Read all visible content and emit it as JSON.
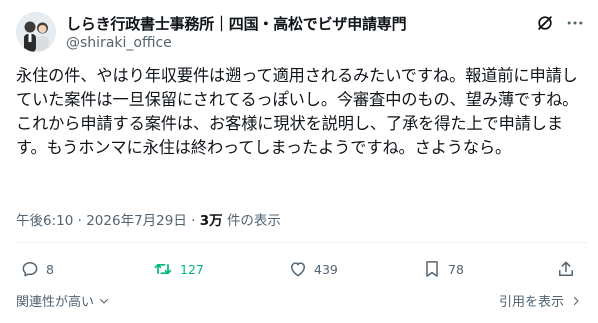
{
  "account": {
    "display_name": "しらき行政書士事務所｜四国・高松でビザ申請専門",
    "handle": "@shiraki_office"
  },
  "post": {
    "text": "永住の件、やはり年収要件は遡って適用されるみたいですね。報道前に申請していた案件は一旦保留にされてるっぽいし。今審査中のもの、望み薄ですね。これから申請する案件は、お客様に現状を説明し、了承を得た上で申請します。もうホンマに永住は終わってしまったようですね。さようなら。",
    "time": "午後6:10",
    "date": "2026年7月29日",
    "views_count": "3万",
    "views_label": "件の表示"
  },
  "actions": {
    "replies": "8",
    "reposts": "127",
    "likes": "439",
    "bookmarks": "78"
  },
  "footer": {
    "sort_label": "関連性が高い",
    "quotes_label": "引用を表示"
  },
  "colors": {
    "text": "#0f1419",
    "secondary": "#536471",
    "repost_active": "#00ba7c"
  }
}
